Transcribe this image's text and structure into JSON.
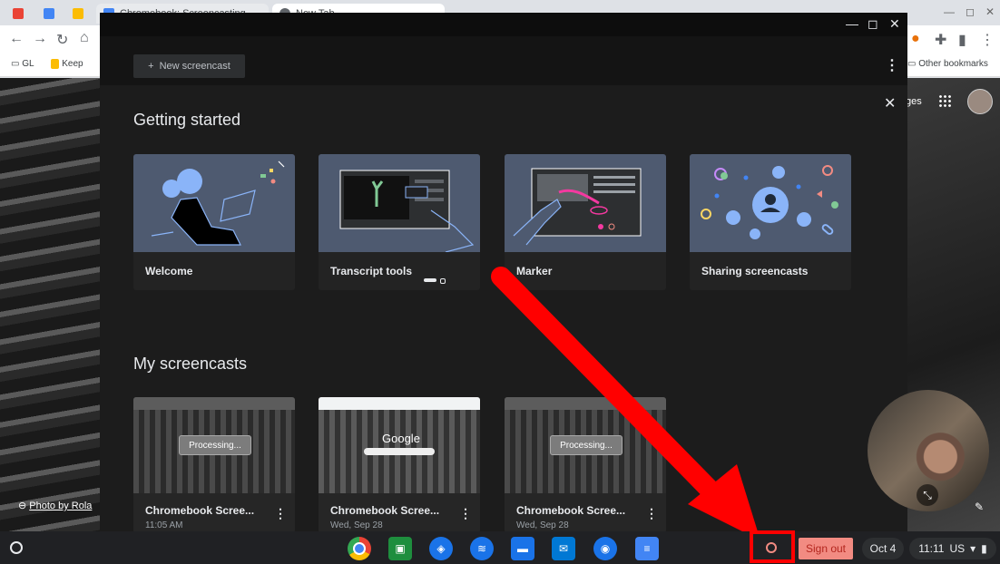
{
  "browser": {
    "tabs": [
      {
        "label": "",
        "color": "#ea4335"
      },
      {
        "label": "",
        "color": "#4285f4"
      },
      {
        "label": "",
        "color": "#fbbc04"
      },
      {
        "label": "Chromebook: Screencasting",
        "color": "#4285f4"
      },
      {
        "label": "New Tab",
        "color": "#5f6368"
      }
    ],
    "bookmarks": [
      "GL",
      "Keep"
    ],
    "other_bookmarks": "Other bookmarks",
    "ntp_link": "ges"
  },
  "app": {
    "new_screencast": "New screencast",
    "getting_started_title": "Getting started",
    "cards": [
      "Welcome",
      "Transcript tools",
      "Marker",
      "Sharing screencasts"
    ],
    "my_screencasts_title": "My screencasts",
    "screencasts": [
      {
        "title": "Chromebook Scree...",
        "date": "11:05 AM",
        "status": "Processing..."
      },
      {
        "title": "Chromebook Scree...",
        "date": "Wed, Sep 28",
        "status": ""
      },
      {
        "title": "Chromebook Scree...",
        "date": "Wed, Sep 28",
        "status": "Processing..."
      }
    ]
  },
  "wallpaper": {
    "photo_credit": "Photo by Rola"
  },
  "shelf": {
    "sign_out": "Sign out",
    "date": "Oct 4",
    "time": "11:11",
    "locale": "US"
  },
  "colors": {
    "accent_red": "#ff0000",
    "signout_bg": "#f28b82"
  }
}
